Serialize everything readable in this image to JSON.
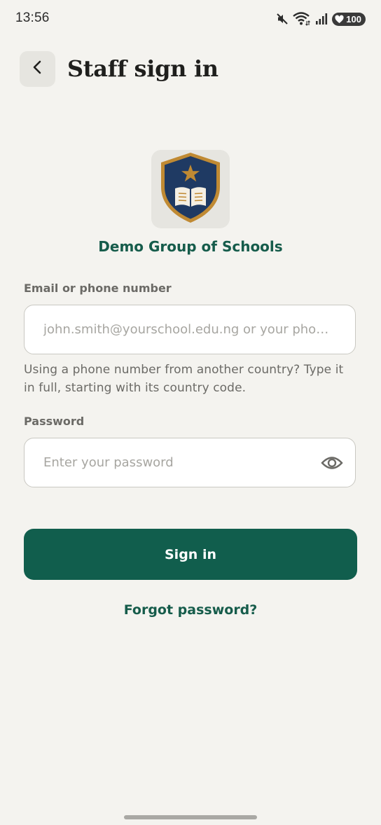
{
  "status_bar": {
    "time": "13:56",
    "battery": "100",
    "icons": [
      "mute-icon",
      "wifi-icon",
      "signal-icon",
      "battery-icon"
    ]
  },
  "header": {
    "title": "Staff sign in",
    "back_icon": "chevron-left-icon"
  },
  "school": {
    "name": "Demo Group of Schools",
    "logo_icon": "school-crest-icon"
  },
  "form": {
    "email": {
      "label": "Email or phone number",
      "placeholder": "john.smith@yourschool.edu.ng or your phone number",
      "value": "",
      "helper": "Using a phone number from another country? Type it in full, starting with its country code."
    },
    "password": {
      "label": "Password",
      "placeholder": "Enter your password",
      "value": "",
      "toggle_icon": "eye-icon"
    },
    "submit_label": "Sign in",
    "forgot_label": "Forgot password?"
  },
  "colors": {
    "background": "#f4f3ef",
    "primary": "#115e4d",
    "accent_text": "#165c4b",
    "crest_navy": "#1f3a63",
    "crest_gold": "#c08a33"
  }
}
